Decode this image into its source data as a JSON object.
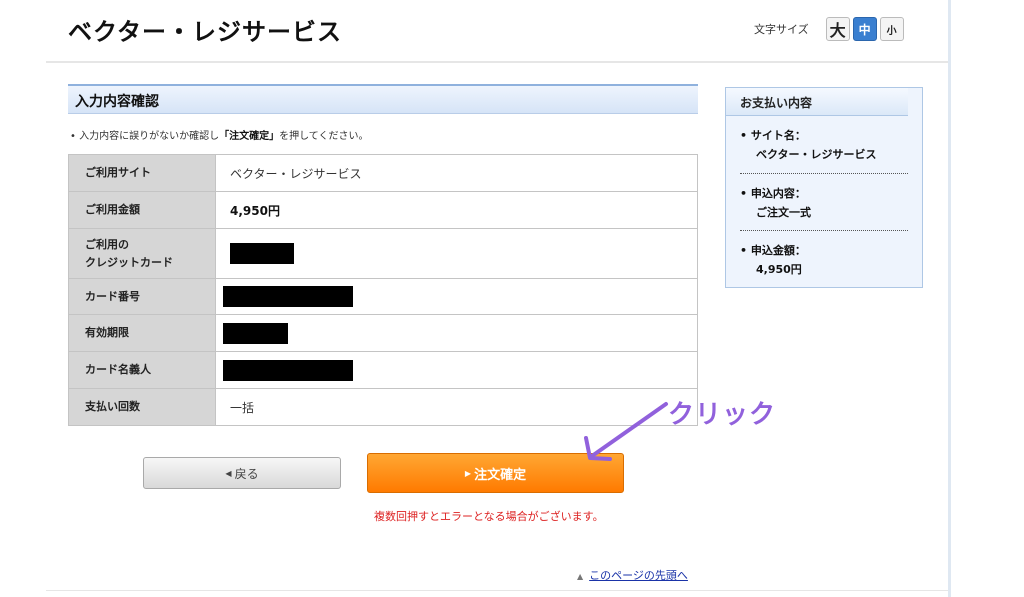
{
  "header": {
    "site_title": "ベクター・レジサービス",
    "font_size_label": "文字サイズ",
    "font_sizes": [
      "大",
      "中",
      "小"
    ],
    "font_size_selected": "中"
  },
  "section": {
    "title": "入力内容確認",
    "note_prefix": "入力内容に誤りがないか確認し",
    "note_emphasis": "「注文確定」",
    "note_suffix": "を押してください。"
  },
  "table": {
    "rows": [
      {
        "label": "ご利用サイト",
        "value": "ベクター・レジサービス"
      },
      {
        "label": "ご利用金額",
        "value": "4,950円"
      },
      {
        "label": "ご利用の\nクレジットカード",
        "value": ""
      },
      {
        "label": "カード番号",
        "value": ""
      },
      {
        "label": "有効期限",
        "value": ""
      },
      {
        "label": "カード名義人",
        "value": ""
      },
      {
        "label": "支払い回数",
        "value": "一括"
      }
    ]
  },
  "buttons": {
    "back_label": "戻る",
    "confirm_label": "注文確定"
  },
  "warning": "複数回押すとエラーとなる場合がございます。",
  "annotation": {
    "label": "クリック",
    "color": "#9161dc"
  },
  "footer": {
    "page_top": "このページの先頭へ"
  },
  "summary": {
    "title": "お支払い内容",
    "items": [
      {
        "label": "サイト名：",
        "value": "ベクター・レジサービス"
      },
      {
        "label": "申込内容：",
        "value": "ご注文一式"
      },
      {
        "label": "申込金額：",
        "value": "4,950円"
      }
    ]
  },
  "colors": {
    "accent": "#ff8a00",
    "header_blue": "#d6e4f7",
    "selected_fontsize": "#3a7fd0",
    "warning": "#dd2222"
  }
}
